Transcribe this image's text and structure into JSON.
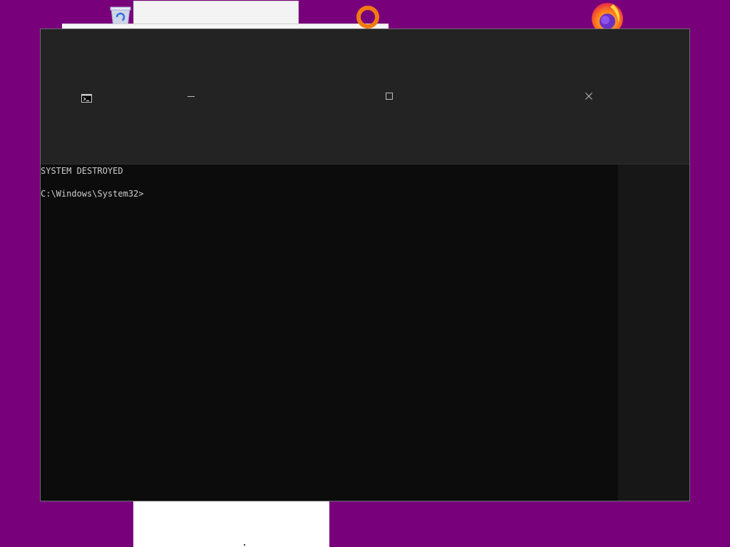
{
  "console": {
    "lines": [
      "SYSTEM DESTROYED",
      "",
      "C:\\Windows\\System32>"
    ]
  },
  "icons": {
    "app": "command-prompt-icon",
    "minimize": "minimize-icon",
    "maximize": "maximize-icon",
    "close": "close-icon",
    "desktop": [
      "recycle-bin-icon",
      "ring-app-icon",
      "firefox-icon"
    ]
  },
  "colors": {
    "desktop_background": "#78007a",
    "titlebar": "#232323",
    "console_background": "#0c0c0c",
    "console_text": "#cccccc"
  }
}
